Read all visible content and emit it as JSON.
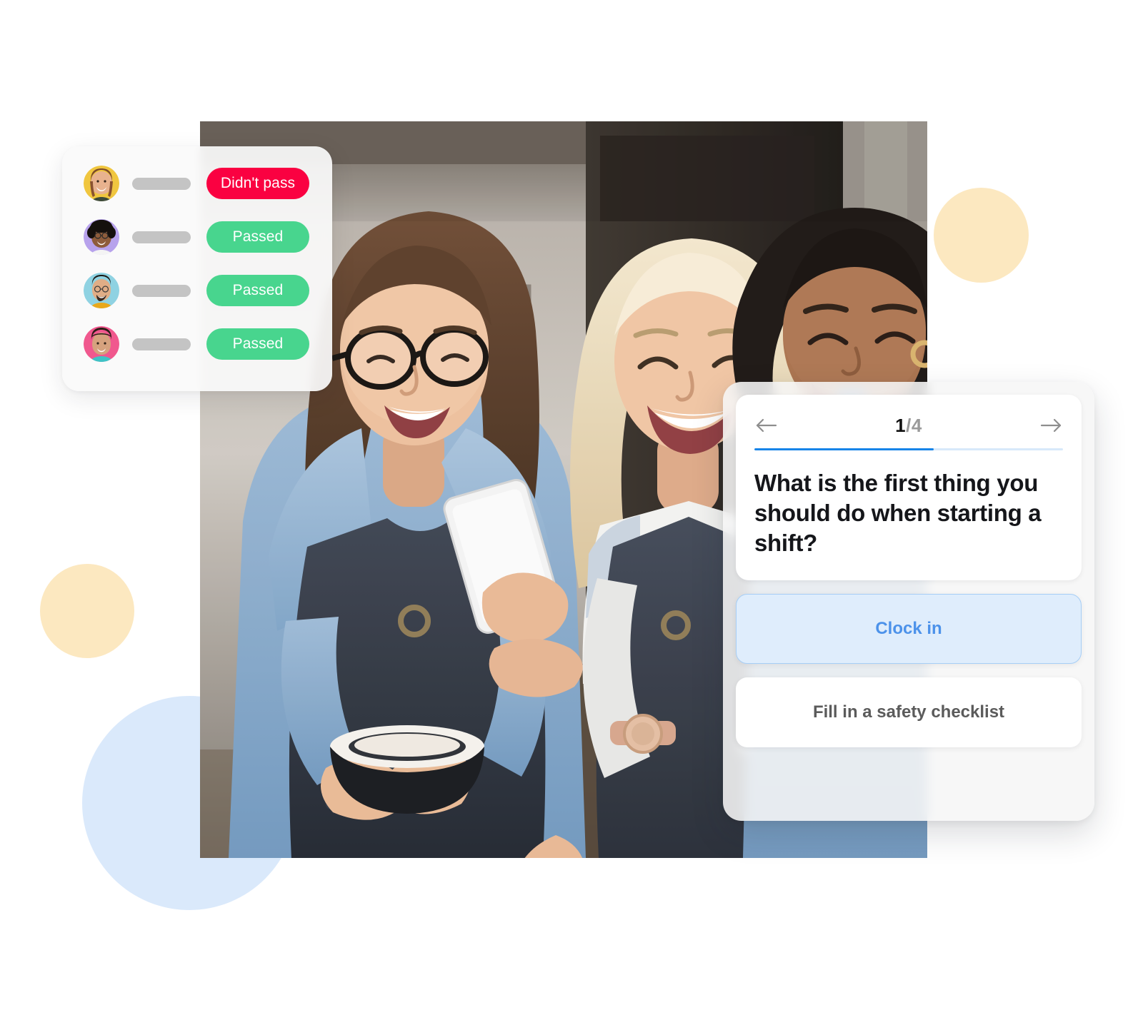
{
  "scene": {
    "title": "Team training results and mobile quiz",
    "background_color": "#ffffff"
  },
  "decor": {
    "circles": [
      {
        "name": "cream-circle-right",
        "color": "#FCE8C0"
      },
      {
        "name": "cream-circle-left",
        "color": "#FCE8C0"
      },
      {
        "name": "blue-circle",
        "color": "#DAE9FB"
      }
    ]
  },
  "photo": {
    "alt": "Three smiling cafe workers in denim shirts and dark aprons looking at a phone",
    "people": [
      {
        "name": "barista-left",
        "detail": "woman with glasses holding a black cup"
      },
      {
        "name": "barista-center",
        "detail": "blonde woman holding a white phone"
      },
      {
        "name": "barista-right",
        "detail": "woman laughing in denim shirt"
      }
    ]
  },
  "status_card": {
    "name": "training-results-card",
    "rows": [
      {
        "avatar_name": "avatar-woman-yellow",
        "avatar_color": "#F0C63F",
        "status": "Didn't pass",
        "status_type": "fail",
        "status_color": "#FA0141"
      },
      {
        "avatar_name": "avatar-woman-purple",
        "avatar_color": "#B7A2EC",
        "status": "Passed",
        "status_type": "pass",
        "status_color": "#48D58E"
      },
      {
        "avatar_name": "avatar-man-blue",
        "avatar_color": "#8FD2E2",
        "status": "Passed",
        "status_type": "pass",
        "status_color": "#48D58E"
      },
      {
        "avatar_name": "avatar-woman-pink",
        "avatar_color": "#F0588E",
        "status": "Passed",
        "status_type": "pass",
        "status_color": "#48D58E"
      }
    ],
    "name_placeholder_color": "#C4C4C4"
  },
  "quiz_card": {
    "name": "quiz-card",
    "nav": {
      "back_icon": "arrow-left-icon",
      "forward_icon": "arrow-right-icon",
      "current": "1",
      "separator": "/4",
      "counter_full": "1/4"
    },
    "progress": {
      "percent": 58,
      "fill_color": "#1784E8",
      "track_color": "#D7E9FA"
    },
    "question": "What is the first thing you should do when starting a shift?",
    "answers": [
      {
        "label": "Clock in",
        "state": "selected",
        "text_color": "#4C92EA",
        "background": "#DFEDFC",
        "border_color": "#A6CEF6"
      },
      {
        "label": "Fill in a safety checklist",
        "state": "default",
        "text_color": "#5b5b5b",
        "background": "#ffffff"
      }
    ]
  }
}
